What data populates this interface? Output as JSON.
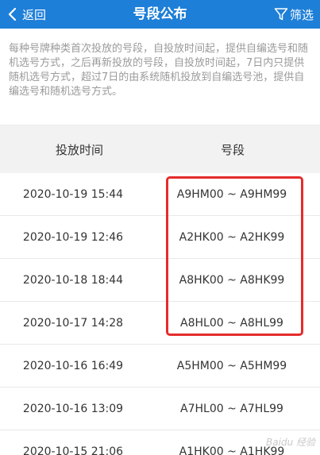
{
  "header": {
    "back_label": "返回",
    "title": "号段公布",
    "filter_label": "筛选"
  },
  "notice": {
    "text": "每种号牌种类首次投放的号段，自投放时间起，提供自编选号和随机选号方式，之后再新投放的号段，自投放时间起，7日内只提供随机选号方式，超过7日的由系统随机投放到自编选号池，提供自编选号和随机选号方式。"
  },
  "table": {
    "columns": [
      "投放时间",
      "号段"
    ],
    "rows": [
      {
        "time": "2020-10-19 15:44",
        "range": "A9HM00 ~ A9HM99"
      },
      {
        "time": "2020-10-19 12:46",
        "range": "A2HK00 ~ A2HK99"
      },
      {
        "time": "2020-10-18 18:44",
        "range": "A8HK00 ~ A8HK99"
      },
      {
        "time": "2020-10-17 14:28",
        "range": "A8HL00 ~ A8HL99"
      },
      {
        "time": "2020-10-16 16:49",
        "range": "A5HM00 ~ A5HM99"
      },
      {
        "time": "2020-10-16 13:09",
        "range": "A7HL00 ~ A7HL99"
      },
      {
        "time": "2020-10-15 21:06",
        "range": "A1HK00 ~ A1HK99"
      }
    ]
  },
  "watermark": "Baidu 经验",
  "colors": {
    "header_bg": "#1e7fd8",
    "highlight_border": "#e52b2b"
  }
}
